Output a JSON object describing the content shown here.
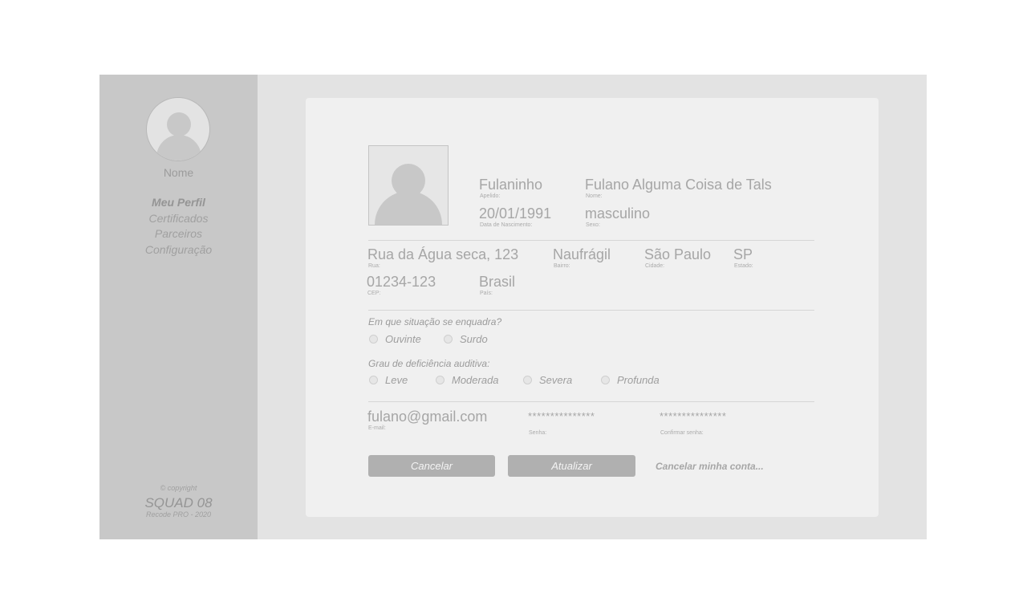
{
  "sidebar": {
    "name": "Nome",
    "menu": [
      {
        "label": "Meu Perfil"
      },
      {
        "label": "Certificados"
      },
      {
        "label": "Parceiros"
      },
      {
        "label": "Configuração"
      }
    ],
    "copyright": "© copyright",
    "squad": "SQUAD 08",
    "recode": "Recode PRO - 2020"
  },
  "profile": {
    "apelido": {
      "value": "Fulaninho",
      "label": "Apelido:"
    },
    "nome": {
      "value": "Fulano Alguma Coisa de Tals",
      "label": "Nome:"
    },
    "nascimento": {
      "value": "20/01/1991",
      "label": "Data de Nascimento:"
    },
    "sexo": {
      "value": "masculino",
      "label": "Sexo:"
    }
  },
  "address": {
    "rua": {
      "value": "Rua da Água seca, 123",
      "label": "Rua:"
    },
    "bairro": {
      "value": "Naufrágil",
      "label": "Bairro:"
    },
    "cidade": {
      "value": "São Paulo",
      "label": "Cidade:"
    },
    "estado": {
      "value": "SP",
      "label": "Estado:"
    },
    "cep": {
      "value": "01234-123",
      "label": "CEP:"
    },
    "pais": {
      "value": "Brasil",
      "label": "País:"
    }
  },
  "situation": {
    "question": "Em que situação se enquadra?",
    "options": [
      {
        "label": "Ouvinte"
      },
      {
        "label": "Surdo"
      }
    ]
  },
  "degree": {
    "question": "Grau de deficiência auditiva:",
    "options": [
      {
        "label": "Leve"
      },
      {
        "label": "Moderada"
      },
      {
        "label": "Severa"
      },
      {
        "label": "Profunda"
      }
    ]
  },
  "account": {
    "email": {
      "value": "fulano@gmail.com",
      "label": "E-mail:"
    },
    "senha": {
      "value": "***************",
      "label": "Senha:"
    },
    "confirmar": {
      "value": "***************",
      "label": "Confirmar senha:"
    }
  },
  "actions": {
    "cancel": "Cancelar",
    "update": "Atualizar",
    "delete_account": "Cancelar minha conta..."
  },
  "colors": {
    "sidebar_bg": "#c8c8c8",
    "frame_bg": "#e3e3e3",
    "card_bg": "#f0f0f0",
    "button_bg": "#b0b0b0"
  },
  "icons": {
    "sidebar_avatar": "user-avatar-icon",
    "profile_photo": "user-photo-icon"
  }
}
